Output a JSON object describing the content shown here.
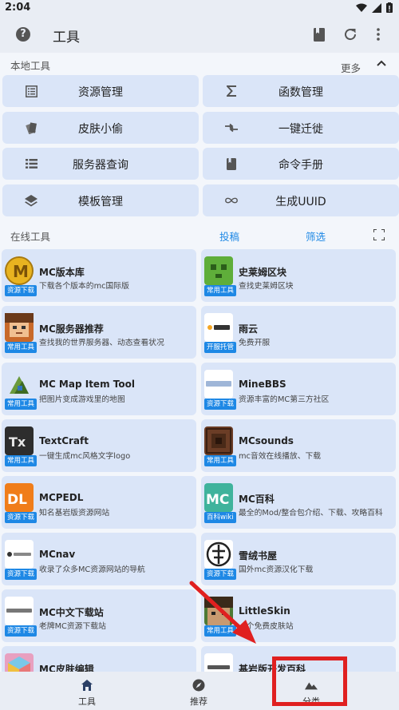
{
  "status": {
    "time": "2:04"
  },
  "appbar": {
    "title": "工具"
  },
  "local": {
    "label": "本地工具",
    "more": "更多",
    "buttons": [
      {
        "label": "资源管理",
        "icon": "list-box-icon"
      },
      {
        "label": "函数管理",
        "icon": "sigma-icon"
      },
      {
        "label": "皮肤小偷",
        "icon": "cards-icon"
      },
      {
        "label": "一键迁徙",
        "icon": "transfer-icon"
      },
      {
        "label": "服务器查询",
        "icon": "list-icon"
      },
      {
        "label": "命令手册",
        "icon": "book-icon"
      },
      {
        "label": "模板管理",
        "icon": "layers-icon"
      },
      {
        "label": "生成UUID",
        "icon": "infinity-icon"
      }
    ]
  },
  "online": {
    "label": "在线工具",
    "submit": "投稿",
    "filter": "筛选",
    "cards": [
      {
        "name": "MC版本库",
        "desc": "下载各个版本的mc国际版",
        "badge": "资源下载",
        "color": "#e8b320"
      },
      {
        "name": "史莱姆区块",
        "desc": "查找史莱姆区块",
        "badge": "常用工具",
        "color": "#5fae3a"
      },
      {
        "name": "MC服务器推荐",
        "desc": "查找我的世界服务器、动态查看状况",
        "badge": "常用工具",
        "color": "#c8692a"
      },
      {
        "name": "雨云",
        "desc": "免费开服",
        "badge": "开服托管",
        "color": "#ffffff"
      },
      {
        "name": "MC Map Item Tool",
        "desc": "把图片变成游戏里的地图",
        "badge": "常用工具",
        "color": "#6a9a3c"
      },
      {
        "name": "MineBBS",
        "desc": "资源丰富的MC第三方社区",
        "badge": "资源下载",
        "color": "#ffffff"
      },
      {
        "name": "TextCraft",
        "desc": "一键生成mc风格文字logo",
        "badge": "常用工具",
        "color": "#2d2d2d"
      },
      {
        "name": "MCsounds",
        "desc": "mc音效在线播放、下载",
        "badge": "常用工具",
        "color": "#6b3d26"
      },
      {
        "name": "MCPEDL",
        "desc": "知名基岩版资源网站",
        "badge": "资源下载",
        "color": "#f07d1a"
      },
      {
        "name": "MC百科",
        "desc": "最全的Mod/整合包介绍、下载、攻略百科",
        "badge": "百科wiki",
        "color": "#3fb39c"
      },
      {
        "name": "MCnav",
        "desc": "收录了众多MC资源网站的导航",
        "badge": "资源下载",
        "color": "#ffffff"
      },
      {
        "name": "雪绒书屋",
        "desc": "国外mc资源汉化下载",
        "badge": "资源下载",
        "color": "#ffffff"
      },
      {
        "name": "MC中文下载站",
        "desc": "老牌MC资源下载站",
        "badge": "资源下载",
        "color": "#ffffff"
      },
      {
        "name": "LittleSkin",
        "desc": "一个免费皮肤站",
        "badge": "常用工具",
        "color": "#4d7a35"
      },
      {
        "name": "MC皮肤编辑",
        "desc": "",
        "badge": "",
        "color": "#e8a0c0"
      },
      {
        "name": "基岩版开发百科",
        "desc": "",
        "badge": "",
        "color": "#ffffff"
      }
    ]
  },
  "nav": [
    {
      "label": "工具",
      "icon": "home-icon"
    },
    {
      "label": "推荐",
      "icon": "compass-icon"
    },
    {
      "label": "分类",
      "icon": "mountain-icon"
    }
  ]
}
